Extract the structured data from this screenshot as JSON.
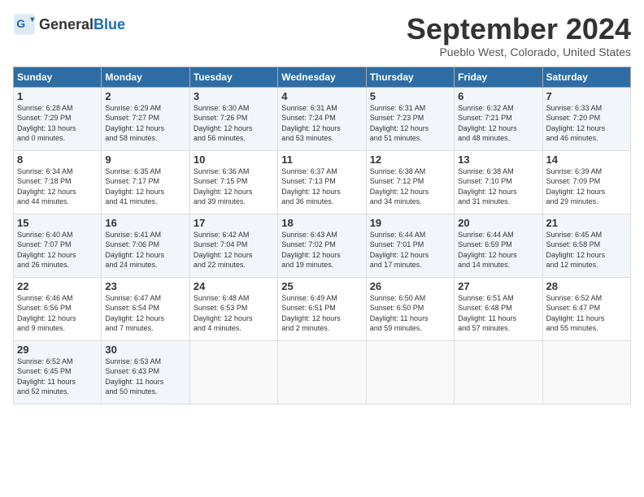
{
  "header": {
    "logo_general": "General",
    "logo_blue": "Blue",
    "month_title": "September 2024",
    "subtitle": "Pueblo West, Colorado, United States"
  },
  "days_of_week": [
    "Sunday",
    "Monday",
    "Tuesday",
    "Wednesday",
    "Thursday",
    "Friday",
    "Saturday"
  ],
  "weeks": [
    [
      {
        "day": "1",
        "info": "Sunrise: 6:28 AM\nSunset: 7:29 PM\nDaylight: 13 hours\nand 0 minutes."
      },
      {
        "day": "2",
        "info": "Sunrise: 6:29 AM\nSunset: 7:27 PM\nDaylight: 12 hours\nand 58 minutes."
      },
      {
        "day": "3",
        "info": "Sunrise: 6:30 AM\nSunset: 7:26 PM\nDaylight: 12 hours\nand 56 minutes."
      },
      {
        "day": "4",
        "info": "Sunrise: 6:31 AM\nSunset: 7:24 PM\nDaylight: 12 hours\nand 53 minutes."
      },
      {
        "day": "5",
        "info": "Sunrise: 6:31 AM\nSunset: 7:23 PM\nDaylight: 12 hours\nand 51 minutes."
      },
      {
        "day": "6",
        "info": "Sunrise: 6:32 AM\nSunset: 7:21 PM\nDaylight: 12 hours\nand 48 minutes."
      },
      {
        "day": "7",
        "info": "Sunrise: 6:33 AM\nSunset: 7:20 PM\nDaylight: 12 hours\nand 46 minutes."
      }
    ],
    [
      {
        "day": "8",
        "info": "Sunrise: 6:34 AM\nSunset: 7:18 PM\nDaylight: 12 hours\nand 44 minutes."
      },
      {
        "day": "9",
        "info": "Sunrise: 6:35 AM\nSunset: 7:17 PM\nDaylight: 12 hours\nand 41 minutes."
      },
      {
        "day": "10",
        "info": "Sunrise: 6:36 AM\nSunset: 7:15 PM\nDaylight: 12 hours\nand 39 minutes."
      },
      {
        "day": "11",
        "info": "Sunrise: 6:37 AM\nSunset: 7:13 PM\nDaylight: 12 hours\nand 36 minutes."
      },
      {
        "day": "12",
        "info": "Sunrise: 6:38 AM\nSunset: 7:12 PM\nDaylight: 12 hours\nand 34 minutes."
      },
      {
        "day": "13",
        "info": "Sunrise: 6:38 AM\nSunset: 7:10 PM\nDaylight: 12 hours\nand 31 minutes."
      },
      {
        "day": "14",
        "info": "Sunrise: 6:39 AM\nSunset: 7:09 PM\nDaylight: 12 hours\nand 29 minutes."
      }
    ],
    [
      {
        "day": "15",
        "info": "Sunrise: 6:40 AM\nSunset: 7:07 PM\nDaylight: 12 hours\nand 26 minutes."
      },
      {
        "day": "16",
        "info": "Sunrise: 6:41 AM\nSunset: 7:06 PM\nDaylight: 12 hours\nand 24 minutes."
      },
      {
        "day": "17",
        "info": "Sunrise: 6:42 AM\nSunset: 7:04 PM\nDaylight: 12 hours\nand 22 minutes."
      },
      {
        "day": "18",
        "info": "Sunrise: 6:43 AM\nSunset: 7:02 PM\nDaylight: 12 hours\nand 19 minutes."
      },
      {
        "day": "19",
        "info": "Sunrise: 6:44 AM\nSunset: 7:01 PM\nDaylight: 12 hours\nand 17 minutes."
      },
      {
        "day": "20",
        "info": "Sunrise: 6:44 AM\nSunset: 6:59 PM\nDaylight: 12 hours\nand 14 minutes."
      },
      {
        "day": "21",
        "info": "Sunrise: 6:45 AM\nSunset: 6:58 PM\nDaylight: 12 hours\nand 12 minutes."
      }
    ],
    [
      {
        "day": "22",
        "info": "Sunrise: 6:46 AM\nSunset: 6:56 PM\nDaylight: 12 hours\nand 9 minutes."
      },
      {
        "day": "23",
        "info": "Sunrise: 6:47 AM\nSunset: 6:54 PM\nDaylight: 12 hours\nand 7 minutes."
      },
      {
        "day": "24",
        "info": "Sunrise: 6:48 AM\nSunset: 6:53 PM\nDaylight: 12 hours\nand 4 minutes."
      },
      {
        "day": "25",
        "info": "Sunrise: 6:49 AM\nSunset: 6:51 PM\nDaylight: 12 hours\nand 2 minutes."
      },
      {
        "day": "26",
        "info": "Sunrise: 6:50 AM\nSunset: 6:50 PM\nDaylight: 11 hours\nand 59 minutes."
      },
      {
        "day": "27",
        "info": "Sunrise: 6:51 AM\nSunset: 6:48 PM\nDaylight: 11 hours\nand 57 minutes."
      },
      {
        "day": "28",
        "info": "Sunrise: 6:52 AM\nSunset: 6:47 PM\nDaylight: 11 hours\nand 55 minutes."
      }
    ],
    [
      {
        "day": "29",
        "info": "Sunrise: 6:52 AM\nSunset: 6:45 PM\nDaylight: 11 hours\nand 52 minutes."
      },
      {
        "day": "30",
        "info": "Sunrise: 6:53 AM\nSunset: 6:43 PM\nDaylight: 11 hours\nand 50 minutes."
      },
      {
        "day": "",
        "info": ""
      },
      {
        "day": "",
        "info": ""
      },
      {
        "day": "",
        "info": ""
      },
      {
        "day": "",
        "info": ""
      },
      {
        "day": "",
        "info": ""
      }
    ]
  ]
}
